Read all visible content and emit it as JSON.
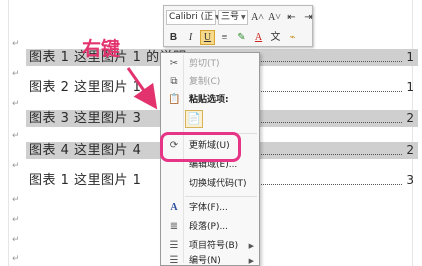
{
  "toc": {
    "entries": [
      {
        "text": "图表 1 这里图片 1 的说明",
        "page": "1",
        "shaded": true
      },
      {
        "text": "图表 2 这里图片 1",
        "page": "1",
        "shaded": false
      },
      {
        "text": "图表 3 这里图片 3",
        "page": "2",
        "shaded": true
      },
      {
        "text": "图表 4 这里图片 4",
        "page": "2",
        "shaded": true
      },
      {
        "text": "图表 1 这里图片 1",
        "page": "3",
        "shaded": false
      }
    ],
    "paragraph_mark": "↵"
  },
  "mini_toolbar": {
    "font_name": "Calibri (正",
    "font_size": "三号",
    "grow_font": "A˄",
    "shrink_font": "A˅",
    "bold": "B",
    "italic": "I",
    "underline": "U",
    "font_color": "A"
  },
  "context_menu": {
    "items": [
      {
        "label": "剪切(T)",
        "icon": "scissors-icon",
        "glyph": "✂",
        "disabled": true
      },
      {
        "label": "复制(C)",
        "icon": "copy-icon",
        "glyph": "⧉",
        "disabled": true
      },
      {
        "label": "粘贴选项:",
        "icon": "paste-icon",
        "glyph": "📋",
        "disabled": false,
        "bold": true
      },
      {
        "label": "更新域(U)",
        "icon": "update-field-icon",
        "glyph": "⟳",
        "disabled": false
      },
      {
        "label": "编辑域(E)...",
        "icon": "",
        "glyph": "",
        "disabled": false
      },
      {
        "label": "切换域代码(T)",
        "icon": "",
        "glyph": "",
        "disabled": false
      },
      {
        "label": "字体(F)...",
        "icon": "font-icon",
        "glyph": "A",
        "disabled": false
      },
      {
        "label": "段落(P)...",
        "icon": "paragraph-icon",
        "glyph": "≣",
        "disabled": false
      },
      {
        "label": "项目符号(B)",
        "icon": "bullets-icon",
        "glyph": "☰",
        "disabled": false,
        "submenu": true
      },
      {
        "label": "编号(N)",
        "icon": "numbering-icon",
        "glyph": "☰",
        "disabled": false,
        "submenu": true
      }
    ],
    "submenu_arrow": "▶"
  },
  "annotation": {
    "label": "右键",
    "color": "#e2336f"
  }
}
